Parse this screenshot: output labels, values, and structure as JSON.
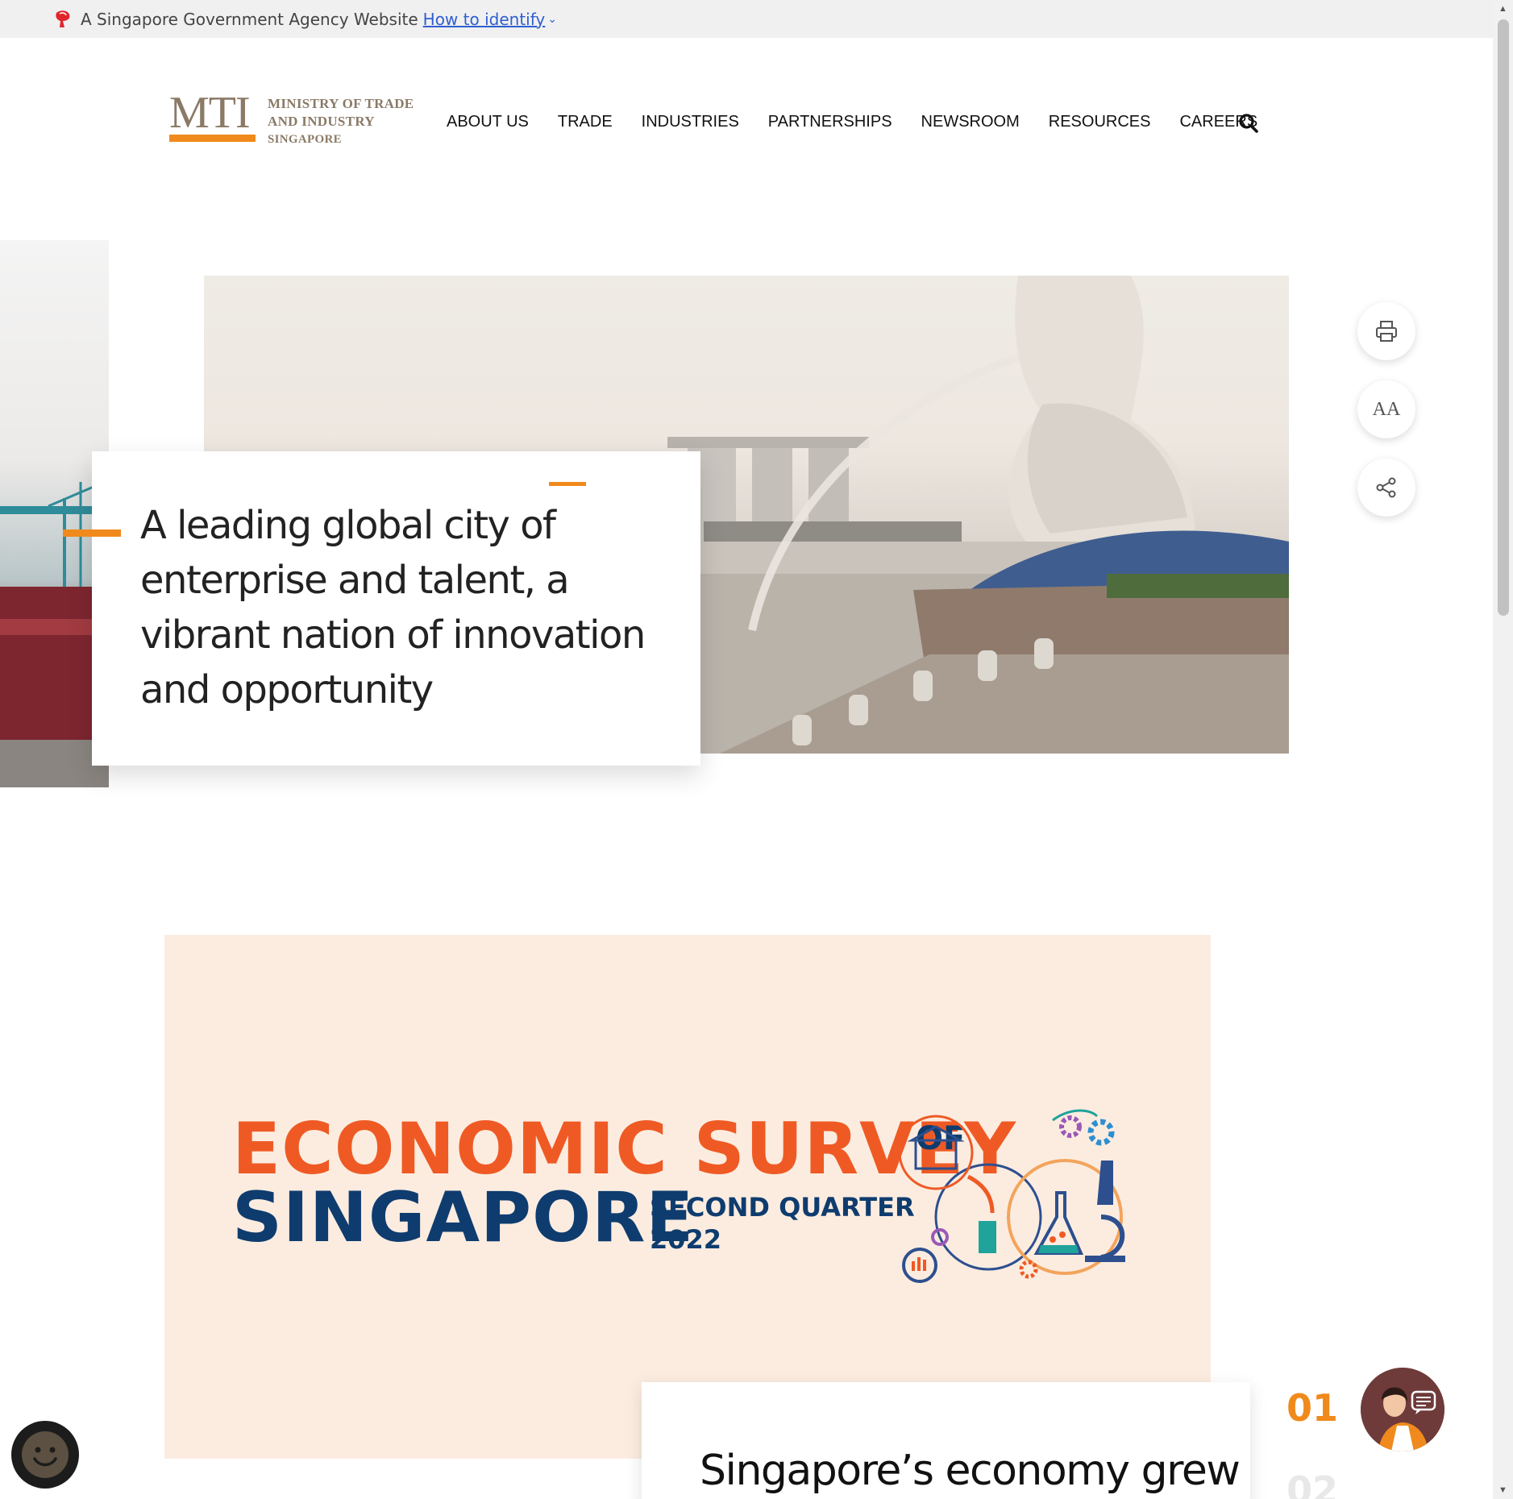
{
  "masthead": {
    "text": "A Singapore Government Agency Website",
    "link": "How to identify"
  },
  "logo": {
    "abbr": "MTI",
    "line1": "MINISTRY OF TRADE",
    "line2": "AND INDUSTRY",
    "line3": "SINGAPORE"
  },
  "nav": {
    "items": [
      "ABOUT US",
      "TRADE",
      "INDUSTRIES",
      "PARTNERSHIPS",
      "NEWSROOM",
      "RESOURCES",
      "CAREERS"
    ]
  },
  "hero": {
    "quote": "A leading global city of enterprise and talent, a vibrant nation of innovation and opportunity"
  },
  "tools": {
    "font_size_label": "AA"
  },
  "survey": {
    "title_line1": "ECONOMIC SURVEY",
    "of": "OF",
    "title_line2": "SINGAPORE",
    "quarter": "SECOND QUARTER",
    "year": "2022"
  },
  "news": {
    "headline": "Singapore’s economy grew"
  },
  "slider": {
    "current": "01",
    "next": "02"
  },
  "colors": {
    "accent": "#f08a1c",
    "survey_orange": "#ef5a24",
    "survey_navy": "#0f3c6e",
    "survey_bg": "#fcece0",
    "link": "#2f5fd0"
  },
  "icons": [
    "lion-head-icon",
    "chevron-down-icon",
    "search-icon",
    "print-icon",
    "font-size-icon",
    "share-icon",
    "chat-avatar-icon",
    "feedback-smiley-icon"
  ]
}
